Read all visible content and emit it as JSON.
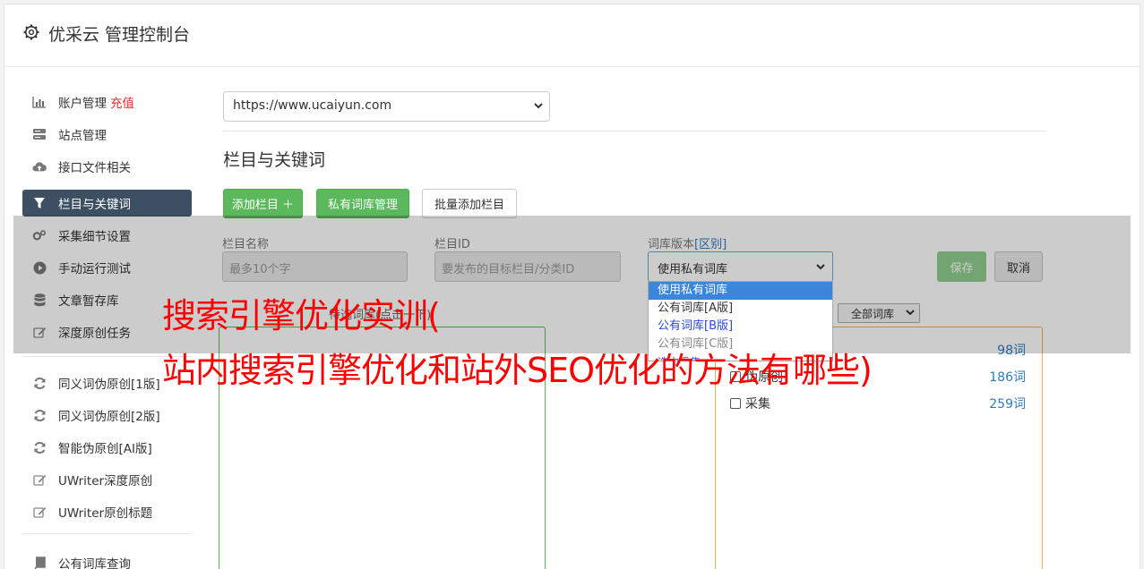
{
  "app": {
    "title": "优采云 管理控制台"
  },
  "sidebar": {
    "items": [
      {
        "label": "账户管理",
        "badge": "充值",
        "icon": "bar-chart-icon"
      },
      {
        "label": "站点管理",
        "icon": "server-icon"
      },
      {
        "label": "接口文件相关",
        "icon": "cloud-upload-icon"
      },
      {
        "label": "栏目与关键词",
        "icon": "filter-icon",
        "active": true
      },
      {
        "label": "采集细节设置",
        "icon": "cogs-icon"
      },
      {
        "label": "手动运行测试",
        "icon": "play-circle-icon"
      },
      {
        "label": "文章暂存库",
        "icon": "database-icon"
      },
      {
        "label": "深度原创任务",
        "icon": "edit-icon"
      },
      {
        "label": "同义词伪原创[1版]",
        "icon": "refresh-icon"
      },
      {
        "label": "同义词伪原创[2版]",
        "icon": "refresh-icon"
      },
      {
        "label": "智能伪原创[AI版]",
        "icon": "refresh-icon"
      },
      {
        "label": "UWriter深度原创",
        "icon": "edit-icon"
      },
      {
        "label": "UWriter原创标题",
        "icon": "edit-icon"
      },
      {
        "label": "公有词库查询",
        "icon": "book-icon"
      }
    ]
  },
  "main": {
    "site_select": {
      "value": "https://www.ucaiyun.com"
    },
    "section_title": "栏目与关键词",
    "buttons": {
      "add_column": "添加栏目 ＋",
      "private_lib": "私有词库管理",
      "batch_add": "批量添加栏目"
    },
    "form": {
      "name_label": "栏目名称",
      "name_placeholder": "最多10个字",
      "id_label": "栏目ID",
      "id_placeholder": "要发布的目标栏目/分类ID",
      "lib_label": "词库版本",
      "lib_label_link": "[区别]",
      "lib_value": "使用私有词库",
      "save": "保存",
      "cancel": "取消"
    },
    "dropdown_options": [
      "使用私有词库",
      "公有词库[A版]",
      "公有词库[B版]",
      "公有词库[C版]",
      "选中采集"
    ],
    "pending_label": "待选词库(点击一下)",
    "all_lib_select": "全部词库",
    "libraries": [
      {
        "name": "",
        "count": "98词"
      },
      {
        "name": "伪原创",
        "count": "186词"
      },
      {
        "name": "采集",
        "count": "259词"
      }
    ]
  },
  "headline": {
    "line1": "搜索引擎优化实训(",
    "line2": "站内搜索引擎优化和站外SEO优化的方法有哪些)"
  }
}
